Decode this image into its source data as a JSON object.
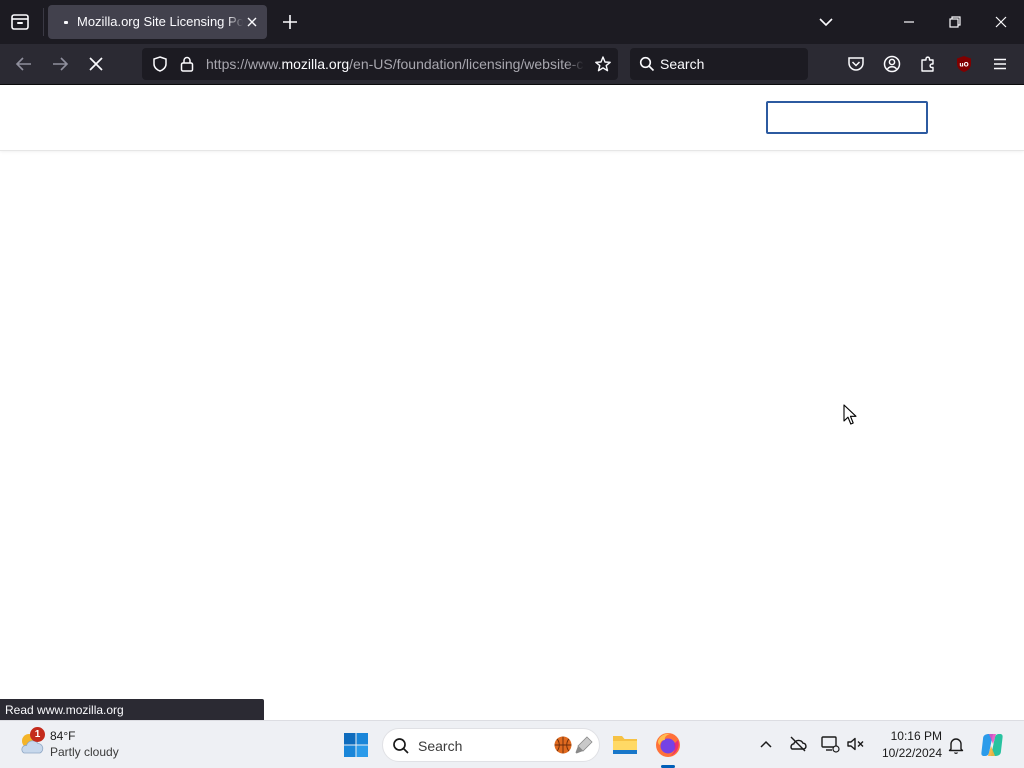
{
  "browser": {
    "tab": {
      "title": "Mozilla.org Site Licensing Policies"
    },
    "nav": {
      "url_prefix": "https://www.",
      "url_host": "mozilla.org",
      "url_path": "/en-US/foundation/licensing/website-content/",
      "search_placeholder": "Search"
    },
    "status_text": "Read www.mozilla.org"
  },
  "page": {
    "search_value": ""
  },
  "taskbar": {
    "weather": {
      "badge": "1",
      "temp": "84°F",
      "desc": "Partly cloudy"
    },
    "search_placeholder": "Search",
    "clock": {
      "time": "10:16 PM",
      "date": "10/22/2024"
    }
  },
  "colors": {
    "titlebar": "#1c1b22",
    "toolbar": "#2b2a33",
    "page_search_border": "#2c5aa0",
    "taskbar": "#eef0f4"
  }
}
